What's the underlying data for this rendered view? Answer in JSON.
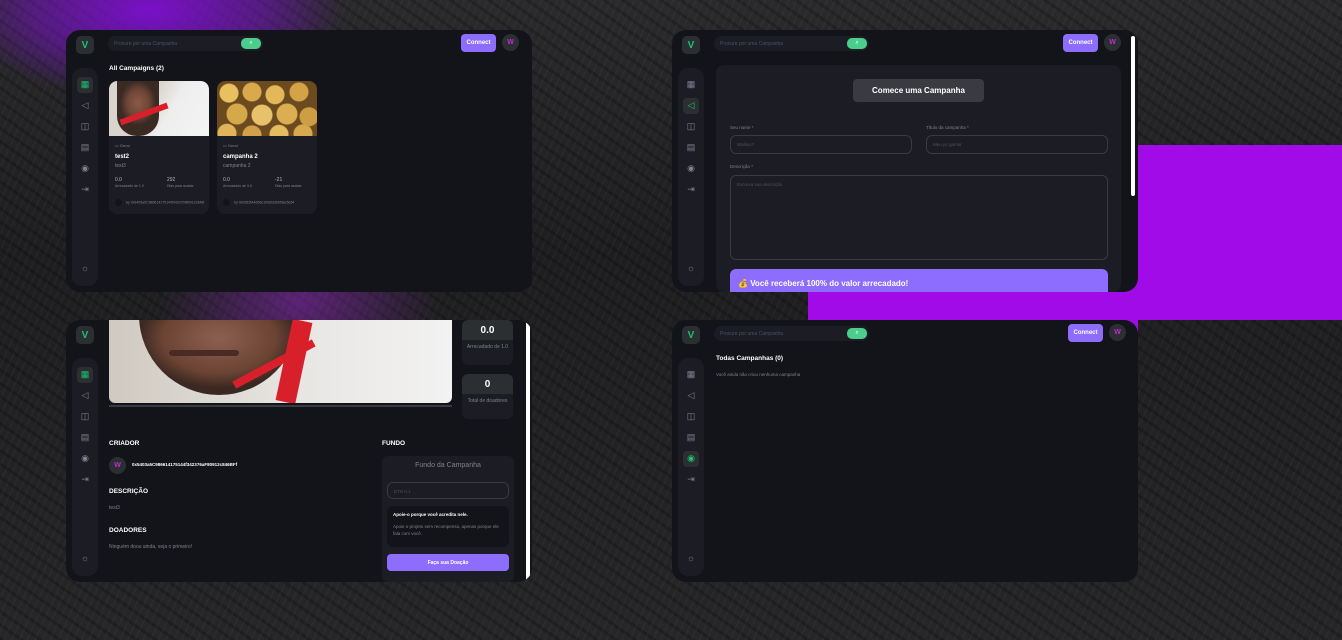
{
  "app": {
    "logo": "V",
    "search_placeholder": "Procure por uma Campanha",
    "connect_label": "Connect",
    "avatar_initials": "W"
  },
  "panel1": {
    "heading": "All Campaigns (2)",
    "cards": [
      {
        "category": "Geral",
        "title": "test2",
        "subtitle": "test3",
        "raised": "0.0",
        "raised_label": "Arrecadado de 1.0",
        "days": "292",
        "days_label": "Dias para acabar",
        "owner_prefix": "by",
        "owner": "0x9405a5C986614175144f34237bfB0912c848f"
      },
      {
        "category": "Geral",
        "title": "campanha 2",
        "subtitle": "campanha 2",
        "raised": "0.0",
        "raised_label": "Arrecadado de 3.0",
        "days": "-21",
        "days_label": "Dias para acabar",
        "owner_prefix": "by",
        "owner": "0x0352fA4d66e1f9d6d3b6fdae5a54"
      }
    ]
  },
  "panel2": {
    "banner": "Comece uma Campanha",
    "name_label": "Seu nome *",
    "name_placeholder": "Walliso?",
    "title_label": "Título da campanha *",
    "title_placeholder": "Meu pc gamer",
    "desc_label": "Descrição *",
    "desc_placeholder": "Escreva sua descrição",
    "bottom_banner": "Você receberá 100% do valor arrecadado!"
  },
  "panel3": {
    "stat1_value": "0.0",
    "stat1_label": "Arrecadado de 1.0",
    "stat2_value": "0",
    "stat2_label": "Total de doadores",
    "creator_heading": "CRIADOR",
    "creator_address": "0x5403a5C986614175144f342376aF80912c846BFf",
    "desc_heading": "DESCRIÇÃO",
    "desc_text": "test3",
    "donors_heading": "DOADORES",
    "donors_text": "Ninguém doou ainda, seja o primeiro!",
    "fund_heading": "FUNDO",
    "fund_title": "Fundo da Campanha",
    "fund_placeholder": "ETH 0.1",
    "support_title": "Apoie-o porque você acredita nele.",
    "support_text": "Apoie o projeto sem recompensa, apenas porque ele fala com você.",
    "donate_label": "Faça sua Doação"
  },
  "panel4": {
    "heading": "Todas Campanhas (0)",
    "empty_text": "Você ainda não criou nenhuma campanha"
  },
  "colors": {
    "accent_green": "#1dc071",
    "accent_purple": "#8c6dfd",
    "panel_bg": "#13131a",
    "card_bg": "#1c1c24",
    "backdrop_purple": "#a10be8"
  }
}
